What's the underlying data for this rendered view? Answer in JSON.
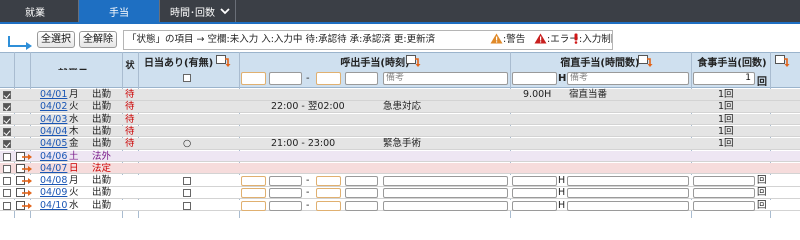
{
  "tabs": [
    {
      "label": "就業",
      "active": false,
      "has_dropdown": true
    },
    {
      "label": "手当",
      "active": true,
      "has_dropdown": false
    },
    {
      "label": "時間･回数",
      "active": false,
      "has_dropdown": true
    }
  ],
  "toolbar": {
    "select_all_label": "全選択",
    "deselect_all_label": "全解除",
    "legend_text": "「状態」の項目 → 空欄:未入力 入:入力中 待:承認待 承:承認済 更:更新済",
    "warning_label": ":警告",
    "error_label": ":エラー",
    "limit_label": ":入力制限"
  },
  "columns": {
    "work_date": "就業日",
    "status": "状態",
    "daily_allowance": "日当あり(有無)",
    "callout_allowance": "呼出手当(時刻)",
    "night_duty_allowance": "宿直手当(時間数)",
    "meal_allowance": "食事手当(回数)"
  },
  "header_inputs": {
    "callout_separator": "-",
    "callout_note_placeholder": "備考",
    "night_duty_note_placeholder": "備考",
    "hour_unit": "H",
    "meal_count_value": "1",
    "count_unit": "回"
  },
  "rows": [
    {
      "date": "04/01",
      "weekday": "月",
      "type": "出勤",
      "status": "待",
      "checked": true,
      "daily": "",
      "callout_time": "",
      "callout_note": "",
      "night_hours": "9.00H",
      "night_note": "宿直当番",
      "meal": "1回",
      "kind": "locked"
    },
    {
      "date": "04/02",
      "weekday": "火",
      "type": "出勤",
      "status": "待",
      "checked": true,
      "daily": "",
      "callout_time": "22:00 - 翌02:00",
      "callout_note": "急患対応",
      "night_hours": "",
      "night_note": "",
      "meal": "1回",
      "kind": "locked"
    },
    {
      "date": "04/03",
      "weekday": "水",
      "type": "出勤",
      "status": "待",
      "checked": true,
      "daily": "",
      "callout_time": "",
      "callout_note": "",
      "night_hours": "",
      "night_note": "",
      "meal": "1回",
      "kind": "locked"
    },
    {
      "date": "04/04",
      "weekday": "木",
      "type": "出勤",
      "status": "待",
      "checked": true,
      "daily": "",
      "callout_time": "",
      "callout_note": "",
      "night_hours": "",
      "night_note": "",
      "meal": "1回",
      "kind": "locked"
    },
    {
      "date": "04/05",
      "weekday": "金",
      "type": "出勤",
      "status": "待",
      "checked": true,
      "daily": "○",
      "callout_time": "21:00 - 23:00",
      "callout_note": "緊急手術",
      "night_hours": "",
      "night_note": "",
      "meal": "1回",
      "kind": "locked"
    },
    {
      "date": "04/06",
      "weekday": "土",
      "type": "法外",
      "status": "",
      "checked": false,
      "daily": "",
      "callout_time": "",
      "callout_note": "",
      "night_hours": "",
      "night_note": "",
      "meal": "",
      "kind": "sat"
    },
    {
      "date": "04/07",
      "weekday": "日",
      "type": "法定",
      "status": "",
      "checked": false,
      "daily": "",
      "callout_time": "",
      "callout_note": "",
      "night_hours": "",
      "night_note": "",
      "meal": "",
      "kind": "sun"
    },
    {
      "date": "04/08",
      "weekday": "月",
      "type": "出勤",
      "status": "",
      "checked": false,
      "daily": "",
      "callout_time": "",
      "callout_note": "",
      "night_hours": "",
      "night_note": "",
      "meal": "",
      "kind": "open"
    },
    {
      "date": "04/09",
      "weekday": "火",
      "type": "出勤",
      "status": "",
      "checked": false,
      "daily": "",
      "callout_time": "",
      "callout_note": "",
      "night_hours": "",
      "night_note": "",
      "meal": "",
      "kind": "open"
    },
    {
      "date": "04/10",
      "weekday": "水",
      "type": "出勤",
      "status": "",
      "checked": false,
      "daily": "",
      "callout_time": "",
      "callout_note": "",
      "night_hours": "",
      "night_note": "",
      "meal": "",
      "kind": "open"
    }
  ],
  "colors": {
    "tab_bar": "#3b3f46",
    "tab_active": "#1e6fc2",
    "header_bg": "#cfe0ef",
    "status_pending": "#cc0000",
    "date_link": "#1b57b5"
  }
}
